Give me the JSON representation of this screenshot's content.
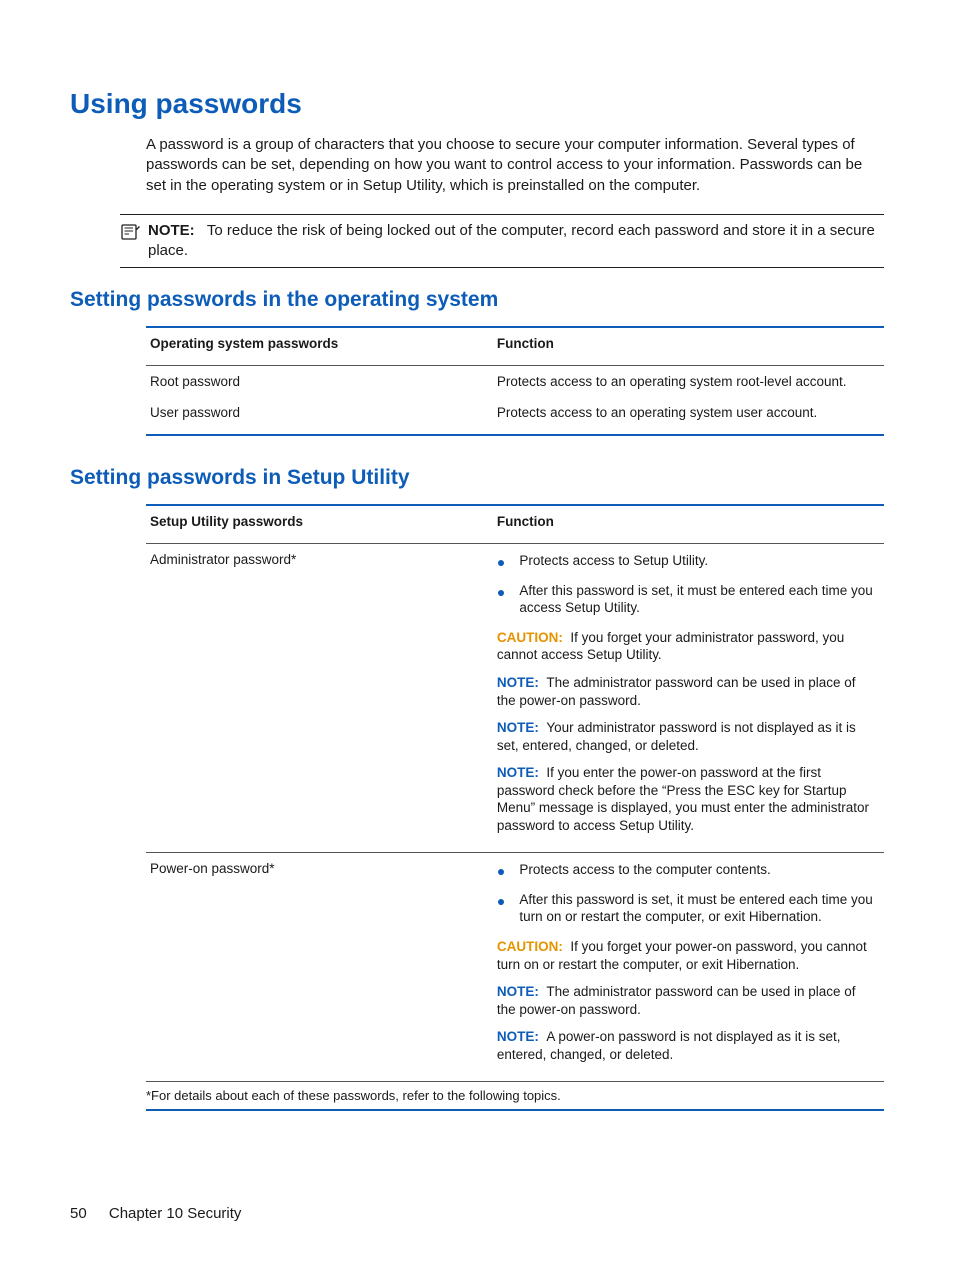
{
  "headings": {
    "h1": "Using passwords",
    "h2a": "Setting passwords in the operating system",
    "h2b": "Setting passwords in Setup Utility"
  },
  "intro": "A password is a group of characters that you choose to secure your computer information. Several types of passwords can be set, depending on how you want to control access to your information. Passwords can be set in the operating system or in Setup Utility, which is preinstalled on the computer.",
  "top_note": {
    "label": "NOTE:",
    "text": "To reduce the risk of being locked out of the computer, record each password and store it in a secure place."
  },
  "table1": {
    "headers": {
      "c1": "Operating system passwords",
      "c2": "Function"
    },
    "rows": [
      {
        "c1": "Root password",
        "c2": "Protects access to an operating system root-level account."
      },
      {
        "c1": "User password",
        "c2": "Protects access to an operating system user account."
      }
    ]
  },
  "table2": {
    "headers": {
      "c1": "Setup Utility passwords",
      "c2": "Function"
    },
    "row0": {
      "c1": "Administrator password*",
      "bullets": [
        "Protects access to Setup Utility.",
        "After this password is set, it must be entered each time you access Setup Utility."
      ],
      "caution": {
        "label": "CAUTION:",
        "text": "If you forget your administrator password, you cannot access Setup Utility."
      },
      "note1": {
        "label": "NOTE:",
        "text": "The administrator password can be used in place of the power-on password."
      },
      "note2": {
        "label": "NOTE:",
        "text": "Your administrator password is not displayed as it is set, entered, changed, or deleted."
      },
      "note3": {
        "label": "NOTE:",
        "text": "If you enter the power-on password at the first password check before the “Press the ESC key for Startup Menu” message is displayed, you must enter the administrator password to access Setup Utility."
      }
    },
    "row1": {
      "c1": "Power-on password*",
      "bullets": [
        "Protects access to the computer contents.",
        "After this password is set, it must be entered each time you turn on or restart the computer, or exit Hibernation."
      ],
      "caution": {
        "label": "CAUTION:",
        "text": "If you forget your power-on password, you cannot turn on or restart the computer, or exit Hibernation."
      },
      "note1": {
        "label": "NOTE:",
        "text": "The administrator password can be used in place of the power-on password."
      },
      "note2": {
        "label": "NOTE:",
        "text": "A power-on password is not displayed as it is set, entered, changed, or deleted."
      }
    },
    "footnote": "*For details about each of these passwords, refer to the following topics."
  },
  "footer": {
    "page": "50",
    "chapter": "Chapter 10   Security"
  }
}
